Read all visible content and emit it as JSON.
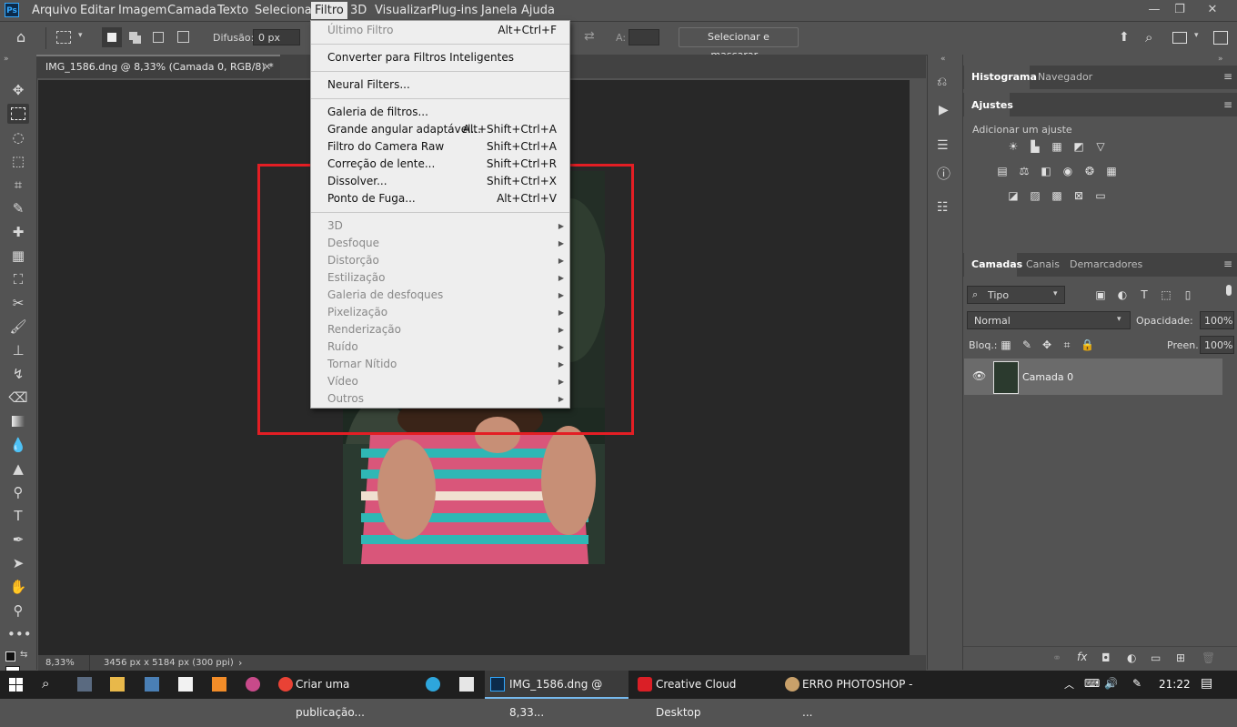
{
  "menubar": {
    "logo": "Ps",
    "items": [
      "Arquivo",
      "Editar",
      "Imagem",
      "Camada",
      "Texto",
      "Selecionar",
      "Filtro",
      "3D",
      "Visualizar",
      "Plug-ins",
      "Janela",
      "Ajuda"
    ],
    "window_controls": [
      "—",
      "❐",
      "✕"
    ]
  },
  "options": {
    "difusao_label": "Difusão:",
    "difusao_value": "0 px",
    "a_label": "A:",
    "select_mask_label": "Selecionar e mascarar..."
  },
  "document": {
    "tab_title": "IMG_1586.dng @ 8,33% (Camada 0, RGB/8) *",
    "zoom": "8,33%",
    "size_info": "3456 px x 5184 px (300 ppi)"
  },
  "filter_menu": {
    "last_filter": "Último Filtro",
    "last_filter_sc": "Alt+Ctrl+F",
    "convert_smart": "Converter para Filtros Inteligentes",
    "neural": "Neural Filters...",
    "gallery": "Galeria de filtros...",
    "wide_angle": "Grande angular adaptável...",
    "wide_angle_sc": "Alt+Shift+Ctrl+A",
    "camera_raw": "Filtro do Camera Raw",
    "camera_raw_sc": "Shift+Ctrl+A",
    "lens": "Correção de lente...",
    "lens_sc": "Shift+Ctrl+R",
    "liquify": "Dissolver...",
    "liquify_sc": "Shift+Ctrl+X",
    "vanishing": "Ponto de Fuga...",
    "vanishing_sc": "Alt+Ctrl+V",
    "submenus": [
      "3D",
      "Desfoque",
      "Distorção",
      "Estilização",
      "Galeria de desfoques",
      "Pixelização",
      "Renderização",
      "Ruído",
      "Tornar Nítido",
      "Vídeo",
      "Outros"
    ]
  },
  "panels": {
    "histogram_tab": "Histograma",
    "navigator_tab": "Navegador",
    "adjustments_tab": "Ajustes",
    "add_adjustment": "Adicionar um ajuste",
    "layers_tab": "Camadas",
    "channels_tab": "Canais",
    "paths_tab": "Demarcadores",
    "filter_type": "Tipo",
    "blend_mode": "Normal",
    "opacity_label": "Opacidade:",
    "opacity_value": "100%",
    "lock_label": "Bloq.:",
    "fill_label": "Preen.:",
    "fill_value": "100%",
    "layer_name": "Camada 0"
  },
  "taskbar": {
    "items": [
      "Criar uma publicação...",
      "IMG_1586.dng @ 8,33...",
      "Creative Cloud Desktop",
      "ERRO PHOTOSHOP - ..."
    ],
    "time": "21:22"
  },
  "colors": {
    "accent_red": "#e31e24",
    "ps_blue": "#31a8ff"
  }
}
